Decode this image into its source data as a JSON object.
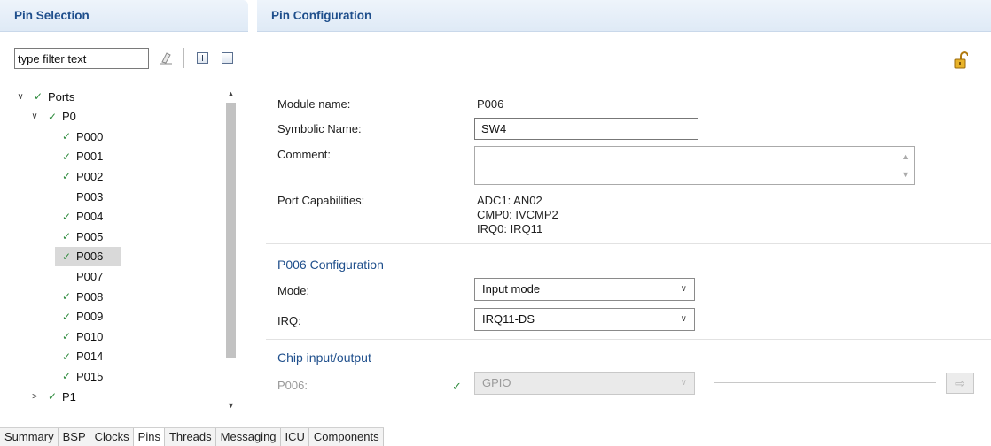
{
  "pin_selection": {
    "title": "Pin Selection",
    "filter_value": "type filter text",
    "tree": [
      {
        "label": "Ports",
        "expanded": true,
        "checked": true,
        "level": 0
      },
      {
        "label": "P0",
        "expanded": true,
        "checked": true,
        "level": 1
      },
      {
        "label": "P000",
        "checked": true,
        "level": 2
      },
      {
        "label": "P001",
        "checked": true,
        "level": 2
      },
      {
        "label": "P002",
        "checked": true,
        "level": 2
      },
      {
        "label": "P003",
        "checked": false,
        "level": 2
      },
      {
        "label": "P004",
        "checked": true,
        "level": 2
      },
      {
        "label": "P005",
        "checked": true,
        "level": 2
      },
      {
        "label": "P006",
        "checked": true,
        "level": 2,
        "selected": true
      },
      {
        "label": "P007",
        "checked": false,
        "level": 2
      },
      {
        "label": "P008",
        "checked": true,
        "level": 2
      },
      {
        "label": "P009",
        "checked": true,
        "level": 2
      },
      {
        "label": "P010",
        "checked": true,
        "level": 2
      },
      {
        "label": "P014",
        "checked": true,
        "level": 2
      },
      {
        "label": "P015",
        "checked": true,
        "level": 2
      },
      {
        "label": "P1",
        "expanded": false,
        "checked": true,
        "level": 1
      }
    ]
  },
  "pin_configuration": {
    "title": "Pin Configuration",
    "module_name_label": "Module name:",
    "module_name_value": "P006",
    "symbolic_name_label": "Symbolic Name:",
    "symbolic_name_value": "SW4",
    "comment_label": "Comment:",
    "comment_value": "",
    "port_capabilities_label": "Port Capabilities:",
    "port_capabilities": [
      "ADC1: AN02",
      "CMP0: IVCMP2",
      "IRQ0: IRQ11"
    ],
    "config_section_title": "P006 Configuration",
    "mode_label": "Mode:",
    "mode_value": "Input mode",
    "irq_label": "IRQ:",
    "irq_value": "IRQ11-DS",
    "chip_io_title": "Chip input/output",
    "chip_pin_label": "P006:",
    "chip_pin_value": "GPIO"
  },
  "tabs": [
    "Summary",
    "BSP",
    "Clocks",
    "Pins",
    "Threads",
    "Messaging",
    "ICU",
    "Components"
  ],
  "active_tab": "Pins",
  "colors": {
    "header_title": "#1f4f8c",
    "check_green": "#2e8b3d",
    "selected_row": "#d9d9d9"
  }
}
